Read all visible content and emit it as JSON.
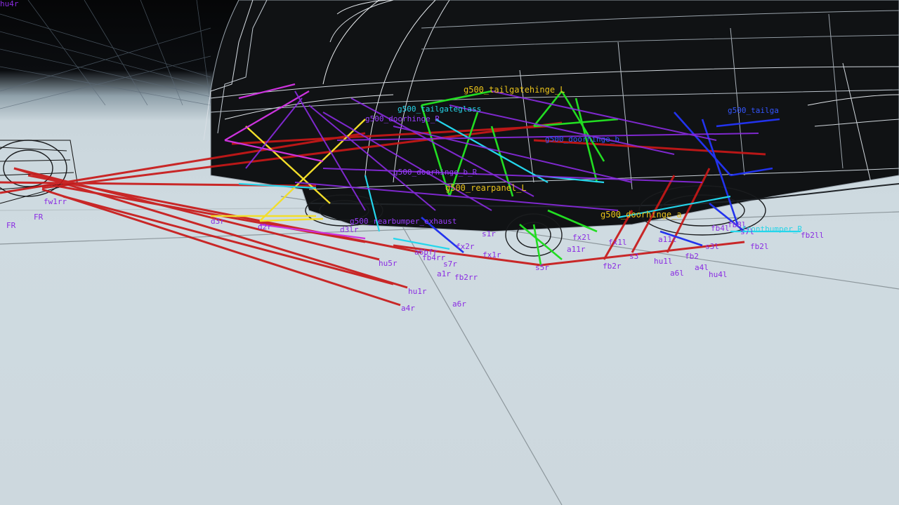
{
  "corner_tag": "hu4r",
  "colors": {
    "sky": "#0b0d10",
    "ground": "#cfdbe1",
    "node_label": "#8a2be2",
    "beam_red": "#c81818",
    "beam_green": "#22dd22",
    "beam_blue": "#2233ee",
    "beam_yellow": "#f2de2a",
    "beam_cyan": "#24d6ec",
    "beam_magenta": "#cc33dd",
    "beam_purple": "#8a2be2",
    "wireframe": "#c9d2da"
  },
  "labels": {
    "fr": "FR",
    "fr2": "FR",
    "hu5r": "hu5r",
    "hu1r": "hu1r",
    "a4r": "a4r",
    "a6r": "a6r",
    "a1r": "a1r",
    "fb2rr": "fb2rr",
    "s7r": "s7r",
    "fb4rr": "fb4rr",
    "a6bfr": "a6bfr",
    "fx1r": "fx1r",
    "fx2r": "fx2r",
    "s1r": "s1r",
    "s5r": "s5r",
    "fb2r": "fb2r",
    "a11r": "a11r",
    "fx2l": "fx2l",
    "fx1l": "fx1l",
    "hu1l": "hu1l",
    "a6l": "a6l",
    "a4l": "a4l",
    "hu4l": "hu4l",
    "fb2": "fb2",
    "s3": "s3",
    "s3l": "s3l",
    "fb2l": "fb2l",
    "fb2ll": "fb2ll",
    "s7l": "s7l",
    "a11l": "a11l",
    "g500_tailgatehinge_l": "g500_tailgatehinge_L",
    "g500_doorhinge_r": "g500_doorhinge_R",
    "g500_rearpanel_l": "g500_rearpanel_L",
    "g500_doorhinge_b": "g500_doorhinge_b",
    "g500_doorhinge_a": "g500_doorhinge_a",
    "g500_glass": "g500_tailgateglass",
    "frontbumper_r": "frontbumper_R",
    "g500_tailgate": "g500_tailga",
    "doorhinge_b_rr": "g500_doorhinge_b_R",
    "d3r": "d3r",
    "d2r": "d2r",
    "d3lr": "d3lr",
    "fw1rr": "fw1rr",
    "rearbumper_exhaust": "g500_rearbumper_exhaust",
    "fb4l": "fb4l",
    "fb8l": "fb8l"
  }
}
